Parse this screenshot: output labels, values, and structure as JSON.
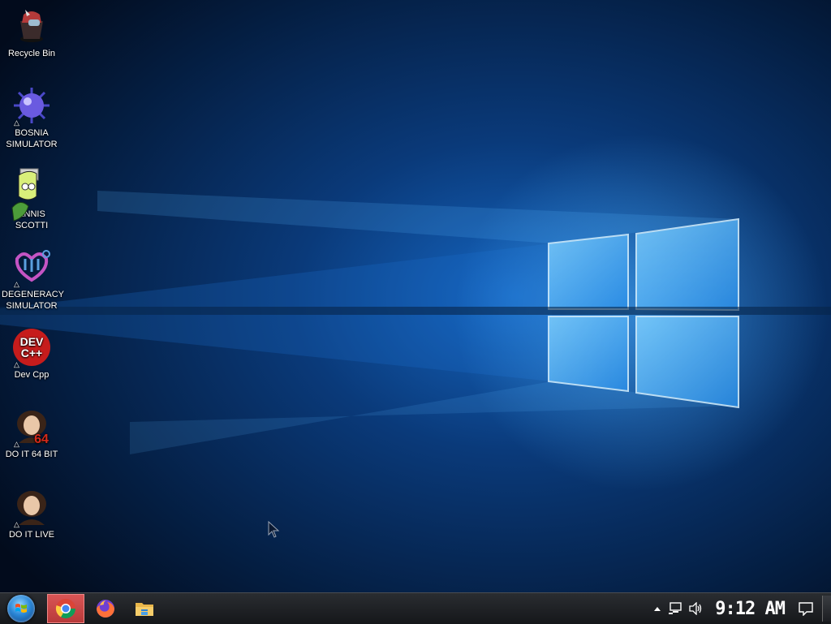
{
  "desktop": {
    "icons": [
      {
        "label": "Recycle Bin",
        "icon": "recycle-bin-icon"
      },
      {
        "label": "BOSNIA SIMULATOR",
        "icon": "spiked-sphere-icon"
      },
      {
        "label": "ENNIS SCOTTI",
        "icon": "character-icon"
      },
      {
        "label": "DEGENERACY SIMULATOR",
        "icon": "heart-symbol-icon"
      },
      {
        "label": "Dev Cpp",
        "icon": "dev-cpp-icon",
        "badge": "DEV C++"
      },
      {
        "label": "DO IT 64 BIT",
        "icon": "portrait-64-icon",
        "badge": "64"
      },
      {
        "label": "DO IT LIVE",
        "icon": "portrait-icon"
      }
    ]
  },
  "taskbar": {
    "pinned": [
      "chrome-icon",
      "firefox-icon",
      "file-explorer-icon"
    ],
    "tray": {
      "clock": "9:12 AM",
      "icons": [
        "chevron-up-icon",
        "network-icon",
        "volume-icon",
        "action-center-icon"
      ]
    }
  },
  "colors": {
    "wallpaper_dark": "#031630",
    "wallpaper_glow": "#1e88e5",
    "taskbar": "#1c1e22",
    "chrome_active": "#c94444"
  }
}
